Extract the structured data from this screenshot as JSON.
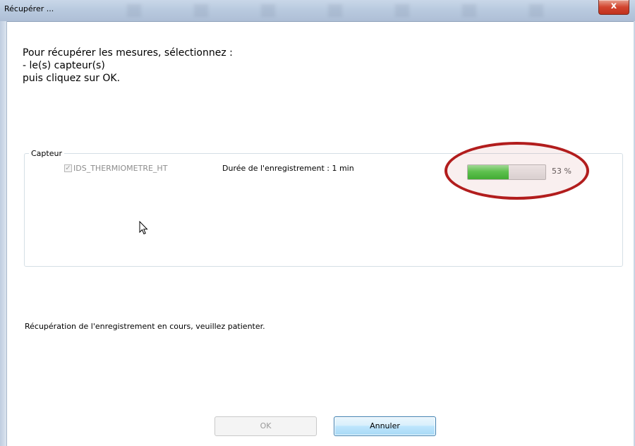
{
  "window": {
    "title": "Récupérer ...",
    "close_glyph": "x"
  },
  "instructions": {
    "line1": "Pour récupérer les mesures, sélectionnez :",
    "line2": "- le(s) capteur(s)",
    "line3": "puis cliquez sur OK."
  },
  "sensor_group": {
    "legend": "Capteur",
    "sensor": {
      "name": "IDS_THERMIOMETRE_HT",
      "checked": true,
      "checkmark": "✓",
      "duration_label": "Durée de l'enregistrement : 1 min",
      "progress_percent": 53,
      "progress_text": "53 %"
    }
  },
  "status_text": "Récupération de l'enregistrement en cours, veuillez patienter.",
  "buttons": {
    "ok_label": "OK",
    "cancel_label": "Annuler"
  },
  "colors": {
    "progress_fill": "#4fcb49",
    "highlight": "#b21d1d",
    "close_button": "#d2452f"
  },
  "icons": {
    "cursor": "arrow-cursor-icon",
    "close": "close-icon"
  }
}
